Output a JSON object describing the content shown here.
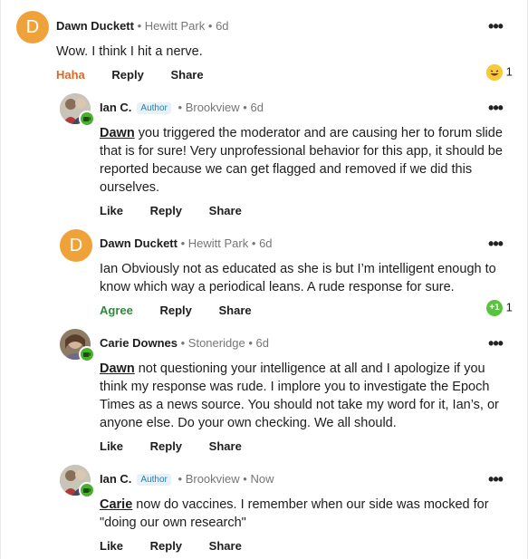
{
  "comments": [
    {
      "author": "Dawn Duckett",
      "avatar_letter": "D",
      "location": "Hewitt Park",
      "time": "6d",
      "text": "Wow.  I think I hit a nerve.",
      "actions": [
        "Haha",
        "Reply",
        "Share"
      ],
      "reaction": {
        "icon": "laughing-emoji",
        "count": "1"
      }
    },
    {
      "author": "Ian C.",
      "author_tag": "Author",
      "location": "Brookview",
      "time": "6d",
      "mention": "Dawn",
      "text": " you triggered the moderator and are causing her to forum slide that is for sure! Very unprofessional behavior for this app, it should be reported because we can get flagged and removed if we did this ourselves.",
      "actions": [
        "Like",
        "Reply",
        "Share"
      ]
    },
    {
      "author": "Dawn Duckett",
      "avatar_letter": "D",
      "location": "Hewitt Park",
      "time": "6d",
      "text": "Ian Obviously not as educated as she is but I’m intelligent enough to know which way a periodical leans.  A rude response for sure.",
      "actions": [
        "Agree",
        "Reply",
        "Share"
      ],
      "reaction": {
        "icon": "plus-one-emoji",
        "glyph": "+1",
        "count": "1"
      }
    },
    {
      "author": "Carie Downes",
      "location": "Stoneridge",
      "time": "6d",
      "mention": "Dawn",
      "text": " not questioning your intelligence at all and I apologize if you think my response was rude.  I implore you to investigate the Epoch Times as a news source.  You should not take my word for it, Ian’s, or anyone else.  Do your own checking.  We all should.",
      "actions": [
        "Like",
        "Reply",
        "Share"
      ]
    },
    {
      "author": "Ian C.",
      "author_tag": "Author",
      "location": "Brookview",
      "time": "Now",
      "mention": "Carie",
      "text": " now do vaccines. I remember when our side was mocked for \"doing our own research\"",
      "actions": [
        "Like",
        "Reply",
        "Share"
      ]
    }
  ],
  "ui": {
    "separator": "•",
    "more_glyph": "•••"
  },
  "colors": {
    "avatar_orange": "#f0a23a",
    "haha_orange": "#d9692b",
    "agree_green": "#2f8a3a",
    "badge_green": "#4caf2f",
    "author_tag_blue": "#2a7fa8"
  }
}
